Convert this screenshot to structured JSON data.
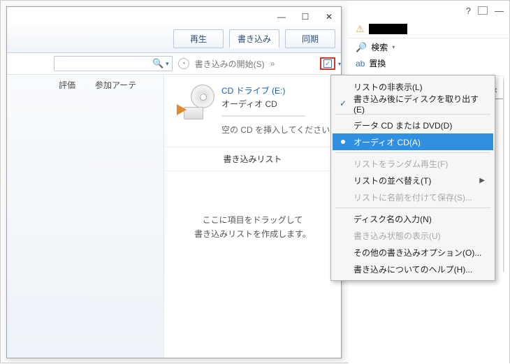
{
  "bg": {
    "help": "?",
    "search_label": "検索",
    "replace_label": "置換",
    "page_close": "×",
    "page_box": "☐",
    "min": "—"
  },
  "wmp": {
    "win": {
      "min": "—",
      "max": "☐",
      "close": "✕"
    },
    "tabs": {
      "play": "再生",
      "burn": "書き込み",
      "sync": "同期"
    },
    "toolbar": {
      "start_burn": "書き込みの開始(S)",
      "chevrons": "»"
    },
    "left": {
      "col1": "評価",
      "col2": "参加アーテ"
    },
    "drive": {
      "name": "CD ドライブ (E:)",
      "type": "オーディオ CD",
      "hint": "空の CD を挿入してください"
    },
    "burn_list_title": "書き込みリスト",
    "drop_hint_l1": "ここに項目をドラッグして",
    "drop_hint_l2": "書き込みリストを作成します。"
  },
  "menu": {
    "hide_list": "リストの非表示(L)",
    "eject_after": "書き込み後にディスクを取り出す(E)",
    "data_cd": "データ CD または DVD(D)",
    "audio_cd": "オーディオ CD(A)",
    "shuffle": "リストをランダム再生(F)",
    "sort": "リストの並べ替え(T)",
    "save_as": "リストに名前を付けて保存(S)...",
    "disc_name": "ディスク名の入力(N)",
    "burn_status": "書き込み状態の表示(U)",
    "other_opts": "その他の書き込みオプション(O)...",
    "help": "書き込みについてのヘルプ(H)..."
  }
}
